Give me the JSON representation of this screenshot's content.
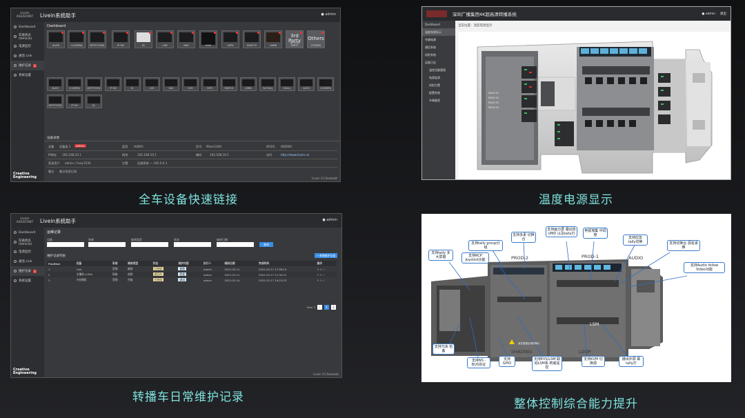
{
  "captions": {
    "p1": "全车设备快速链接",
    "p2": "温度电源显示",
    "p3": "转播车日常维护记录",
    "p4": "整体控制综合能力提升"
  },
  "panel1": {
    "logo_line1": "Livein",
    "logo_line2": "ASSISTANT",
    "title": "Livein系统助手",
    "user": "admin",
    "section": "Dashboard",
    "menu": [
      {
        "label": "Dashboard"
      },
      {
        "label": "车辆状态 (Vehicle)"
      },
      {
        "label": "电源监控"
      },
      {
        "label": "通话 Link"
      },
      {
        "label": "维护记录",
        "badge": "3"
      },
      {
        "label": "系统设置"
      }
    ],
    "devices": [
      "ALIEN",
      "CCAMERA",
      "NETFITCENE",
      "IP SW",
      "KC",
      "LSM",
      "NAS",
      "KVM",
      "VSPX",
      "ENVFCS",
      "LMNB",
      "3rd Party",
      "Others"
    ],
    "big_labels": {
      "third": "3rd Party",
      "others": "Others"
    },
    "bottom_labels": [
      "DEVICE PARTY",
      "OTHERS"
    ],
    "detail_title": "设备详情",
    "detail": {
      "r1": [
        "设备",
        "设备类 1",
        "online",
        "类型",
        "AUDIO",
        "型号",
        "Mixer1004",
        "序列号",
        "000000"
      ],
      "r2": [
        "IP地址",
        "192.168.10.1",
        "网关",
        "192.168.10.1",
        "掩码",
        "192.168.10.1",
        "访问",
        "http://www.livein.cn"
      ],
      "r3": [
        "登录用户",
        "admin / livey7234",
        "位置",
        "运维系统 — 192.0.0.1"
      ],
      "r4": [
        "备注",
        "备注信息记录"
      ]
    },
    "brand1": "Creative",
    "brand2": "Engineering",
    "footer": "Livein V1.Rootwalt"
  },
  "panel2": {
    "title": "深圳广播集团4K超高清转播系统",
    "user": "admin",
    "exit": "退出",
    "breadcrumb": "当前位置：温度电源显示",
    "menu": [
      "Dashboard",
      "温度电源显示",
      "车辆电源",
      "通话系统",
      "机柜系统",
      "运维日志",
      "温控设备管理",
      "电源监测",
      "机柜位置",
      "配置系统",
      "车辆备案"
    ],
    "rack_labels": [
      "RACK 01",
      "RACK 02",
      "RACK 03",
      "RACK 04"
    ]
  },
  "panel3": {
    "logo_line1": "Livein",
    "logo_line2": "ASSISTANT",
    "title": "Livein系统助手",
    "user": "admin",
    "section": "运维记录",
    "menu": [
      {
        "label": "Dashboard"
      },
      {
        "label": "车辆状态 (Vehicle)"
      },
      {
        "label": "电源监控"
      },
      {
        "label": "通话 Link"
      },
      {
        "label": "维护记录",
        "badge": "3"
      },
      {
        "label": "系统设置"
      }
    ],
    "filters": [
      "设备",
      "系统",
      "维修类型",
      "状态",
      "维修日期"
    ],
    "search_btn": "查询",
    "list_title": "维护记录列表",
    "add_btn": "+ 新增维护记录",
    "headers": [
      "Position",
      "设备",
      "系统",
      "维修类型",
      "状态",
      "维护内容",
      "执行人",
      "维修日期",
      "完成时间",
      "操作"
    ],
    "rows": [
      [
        "1",
        "Link",
        "音频",
        "维修",
        "已完成",
        "更换",
        "admin",
        "2022-03-11",
        "2022-03-17 17:58:10",
        "✎ ✕ ✓"
      ],
      [
        "2",
        "主播机 (LSM)",
        "网络",
        "巡检",
        "进行中",
        "检查",
        "admin",
        "2022-03-11",
        "2022-02-17 21:30:21",
        "✎ ✕ ✓"
      ],
      [
        "3",
        "IP交换机",
        "音频",
        "升级",
        "已完成",
        "调试",
        "admin",
        "2022-03-14",
        "2022-02-17 19:23:23",
        "✎ ✕ ✓"
      ]
    ],
    "pager_label": "Total 3",
    "pages": [
      "1",
      "2"
    ],
    "brand1": "Creative",
    "brand2": "Engineering",
    "footer": "Livein V1.Rootwalt"
  },
  "panel4": {
    "areas": [
      "ENG",
      "PROD-2",
      "PROD-1",
      "AUDIO",
      "SHADING",
      "LOOP",
      "LSM"
    ],
    "callouts": [
      "支持tally 多大屏展",
      "支持tally group分组",
      "支持多素 切换合",
      "支持画分屏 幕动态UMD 以及tally灯",
      "电视墙集 中调度",
      "支持应急 tally切换",
      "支持切换台 源名递推",
      "支持Audio follow Video功能",
      "支持RCP Joystick功能",
      "支持冗余 检备",
      "支持NS - BUS协议",
      "支持 GPIO",
      "支持EVS/LSM 联动LSM系 统或遥控",
      "支持KVM 切换源",
      "播出外屏 幕tally灯"
    ],
    "warning": "某些重要区域的警示"
  }
}
